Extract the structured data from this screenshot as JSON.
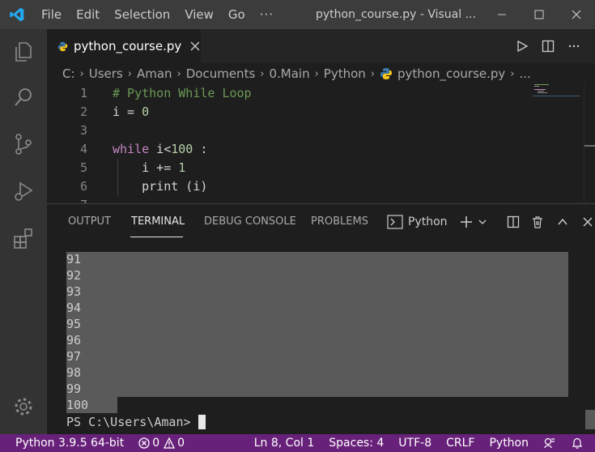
{
  "menu": {
    "items": [
      "File",
      "Edit",
      "Selection",
      "View",
      "Go",
      "···"
    ]
  },
  "window": {
    "title": "python_course.py - Visual ..."
  },
  "tab": {
    "label": "python_course.py"
  },
  "breadcrumb": {
    "parts": [
      "C:",
      "Users",
      "Aman",
      "Documents",
      "0.Main",
      "Python",
      "python_course.py",
      "..."
    ]
  },
  "editor": {
    "lines": [
      {
        "num": "1",
        "tokens": [
          {
            "t": "# Python While Loop",
            "c": "comment"
          }
        ]
      },
      {
        "num": "2",
        "tokens": [
          {
            "t": "i = ",
            "c": "plain"
          },
          {
            "t": "0",
            "c": "num"
          }
        ]
      },
      {
        "num": "3",
        "tokens": []
      },
      {
        "num": "4",
        "tokens": [
          {
            "t": "while",
            "c": "kw"
          },
          {
            "t": " i<",
            "c": "plain"
          },
          {
            "t": "100",
            "c": "num"
          },
          {
            "t": " :",
            "c": "plain"
          }
        ]
      },
      {
        "num": "5",
        "tokens": [
          {
            "t": "    i += ",
            "c": "plain"
          },
          {
            "t": "1",
            "c": "num"
          }
        ]
      },
      {
        "num": "6",
        "tokens": [
          {
            "t": "    print (i)",
            "c": "plain"
          }
        ]
      },
      {
        "num": "7",
        "tokens": []
      }
    ]
  },
  "panel": {
    "tabs": [
      "OUTPUT",
      "TERMINAL",
      "DEBUG CONSOLE",
      "PROBLEMS"
    ],
    "active_tab": "TERMINAL",
    "terminal_name": "Python"
  },
  "terminal": {
    "output": [
      "91",
      "92",
      "93",
      "94",
      "95",
      "96",
      "97",
      "98",
      "99",
      "100"
    ],
    "prompt": "PS C:\\Users\\Aman>"
  },
  "status": {
    "interpreter": "Python 3.9.5 64-bit",
    "errors": "0",
    "warnings": "0",
    "position": "Ln 8, Col 1",
    "spaces": "Spaces: 4",
    "encoding": "UTF-8",
    "eol": "CRLF",
    "language": "Python"
  },
  "colors": {
    "statusbar": "#68217a",
    "titlebar": "#3c3c3c",
    "activitybar": "#333333",
    "accent": "#007acc",
    "comment": "#6a9955",
    "keyword": "#c586c0",
    "number": "#b5cea8"
  },
  "icons": {
    "activity": [
      "explorer-icon",
      "search-icon",
      "source-control-icon",
      "run-debug-icon",
      "extensions-icon",
      "settings-gear-icon"
    ]
  }
}
